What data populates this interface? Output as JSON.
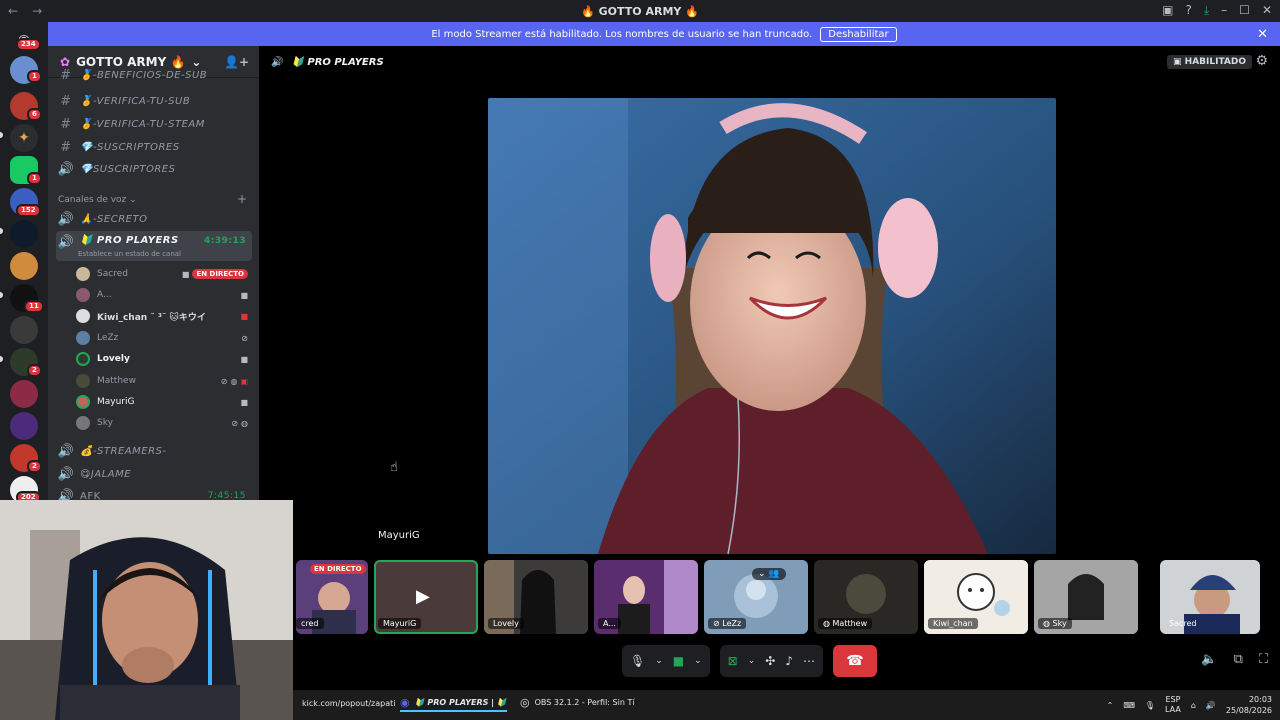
{
  "titlebar": {
    "title": "🔥 GOTTO ARMY 🔥",
    "back_icon": "arrow-left-icon",
    "forward_icon": "arrow-right-icon"
  },
  "rail": {
    "badges": [
      "234",
      "1",
      "6",
      "1",
      "152",
      "11",
      "2",
      "2",
      "202"
    ]
  },
  "banner": {
    "text": "El modo Streamer está habilitado. Los nombres de usuario se han truncado.",
    "button": "Deshabilitar"
  },
  "guild": {
    "name": "GOTTO ARMY 🔥"
  },
  "channels": [
    {
      "name": "-BENEFICIOS-DE-SUB",
      "prefix": "🏅",
      "type": "text"
    },
    {
      "name": "-VERIFICA-TU-SUB",
      "prefix": "🏅",
      "type": "text"
    },
    {
      "name": "-VERIFICA-TU-STEAM",
      "prefix": "🏅",
      "type": "text"
    },
    {
      "name": "-SUSCRIPTORES",
      "prefix": "💎",
      "type": "text"
    },
    {
      "name": "SUSCRIPTORES",
      "prefix": "💎",
      "type": "voice"
    }
  ],
  "voice_category": "Canales de voz",
  "voice_channels": {
    "secreto": "🙏-SECRETO",
    "pro_players": "🔰 PRO PLAYERS",
    "pro_players_time": "4:39:13",
    "pro_players_status": "Establece un estado de canal",
    "streamers": "💰-STREAMERS-",
    "jalame": "😋JALAME",
    "afk": "AFK",
    "afk_time": "7:45:15"
  },
  "voice_users": [
    {
      "name": "Sacred",
      "live": "EN DIRECTO"
    },
    {
      "name": "A..."
    },
    {
      "name": "Kiwi_chan ˘ ³˘ 🐱キウイ"
    },
    {
      "name": "LeZz"
    },
    {
      "name": "Lovely"
    },
    {
      "name": "Matthew"
    },
    {
      "name": "MayuriG"
    },
    {
      "name": "Sky"
    }
  ],
  "stage": {
    "channel": "🔰 PRO PLAYERS",
    "streamer_badge": "HABILITADO",
    "hover_label": "MayuriG"
  },
  "tiles": [
    {
      "name": "cred",
      "live": "EN DIRECTO"
    },
    {
      "name": "MayuriG"
    },
    {
      "name": "Lovely"
    },
    {
      "name": "A..."
    },
    {
      "name": "LeZz"
    },
    {
      "name": "Matthew"
    },
    {
      "name": "Kiwi_chan"
    },
    {
      "name": "Sky"
    },
    {
      "name": "Sacred"
    }
  ],
  "taskbar": {
    "item1": "kick.com/popout/zapati",
    "item2": "🔰 PRO PLAYERS | 🔰",
    "item3": "OBS 32.1.2 - Perfil: Sin Tí",
    "lang1": "ESP",
    "lang2": "LAA",
    "time": "20:03",
    "date": "25/08/2026"
  },
  "colors": {
    "accent": "#5865f2",
    "live": "#da373c",
    "speaking": "#23a55a"
  }
}
